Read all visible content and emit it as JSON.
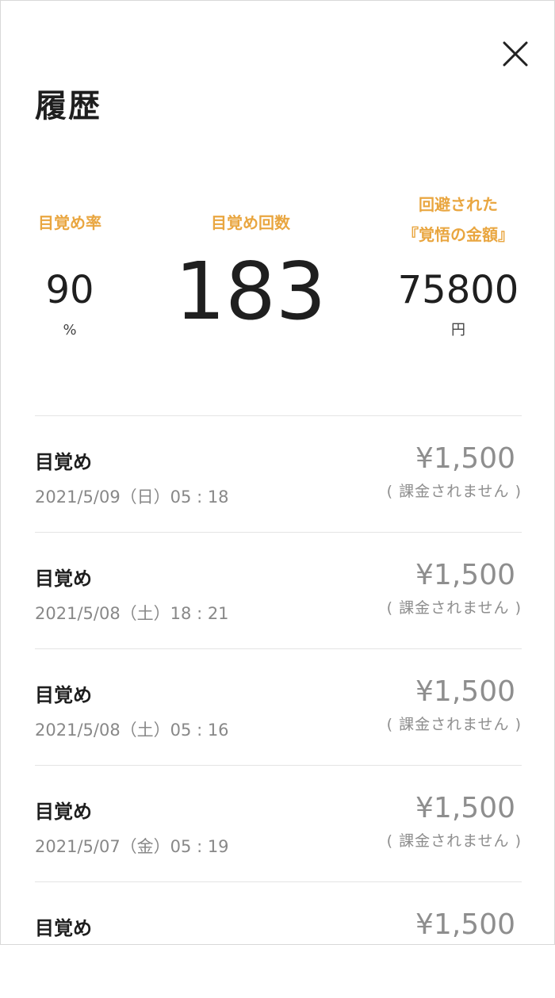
{
  "header": {
    "title": "履歴",
    "close_icon": "close-icon"
  },
  "stats": {
    "wake_rate": {
      "label": "目覚め率",
      "value": "90",
      "unit": "%"
    },
    "wake_count": {
      "label": "目覚め回数",
      "value": "183"
    },
    "avoided_amount": {
      "label_line1": "回避された",
      "label_line2": "『覚悟の金額』",
      "value": "75800",
      "unit": "円"
    },
    "accent_color": "#e9a640"
  },
  "history": [
    {
      "title": "目覚め",
      "datetime": "2021/5/09（日）05 : 18",
      "amount": "¥1,500",
      "note": "( 課金されません )"
    },
    {
      "title": "目覚め",
      "datetime": "2021/5/08（土）18 : 21",
      "amount": "¥1,500",
      "note": "( 課金されません )"
    },
    {
      "title": "目覚め",
      "datetime": "2021/5/08（土）05 : 16",
      "amount": "¥1,500",
      "note": "( 課金されません )"
    },
    {
      "title": "目覚め",
      "datetime": "2021/5/07（金）05 : 19",
      "amount": "¥1,500",
      "note": "( 課金されません )"
    },
    {
      "title": "目覚め",
      "datetime": "",
      "amount": "¥1,500",
      "note": ""
    }
  ]
}
